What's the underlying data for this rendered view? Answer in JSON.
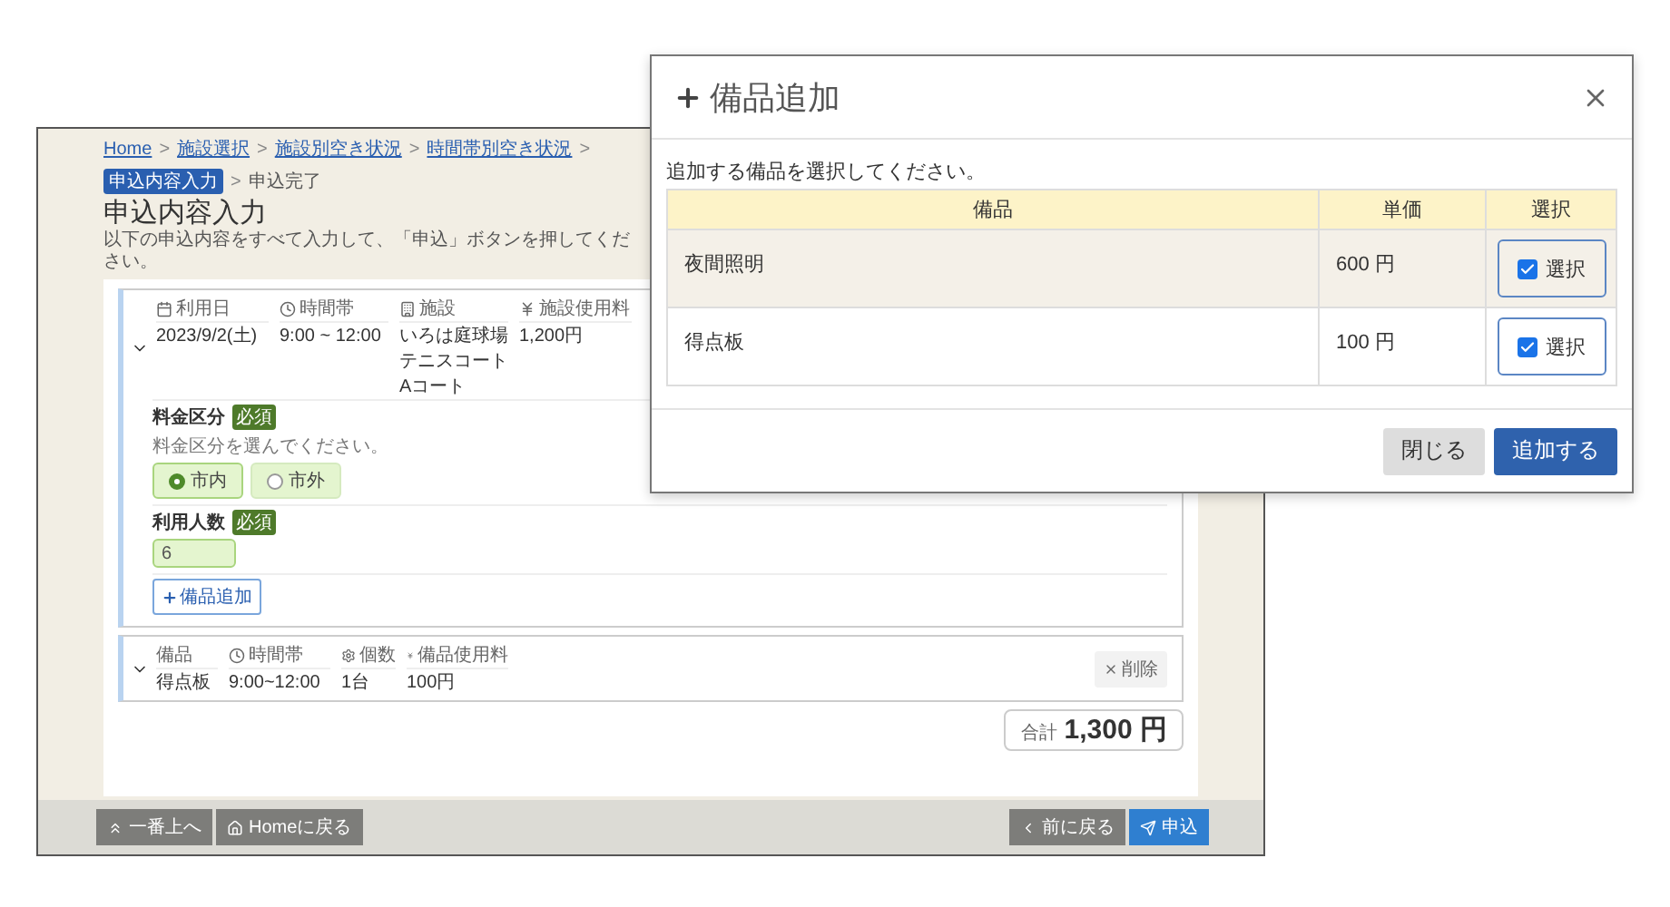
{
  "breadcrumb": [
    {
      "label": "Home",
      "kind": "link"
    },
    {
      "label": "施設選択",
      "kind": "link"
    },
    {
      "label": "施設別空き状況",
      "kind": "link"
    },
    {
      "label": "時間帯別空き状況",
      "kind": "link"
    },
    {
      "label": "申込内容入力",
      "kind": "current"
    },
    {
      "label": "申込完了",
      "kind": "plain"
    }
  ],
  "breadcrumb_separator": ">",
  "page": {
    "title": "申込内容入力",
    "description": "以下の申込内容をすべて入力して、「申込」ボタンを押してください。"
  },
  "usage": {
    "fields": [
      {
        "label": "利用日",
        "value": "2023/9/2(土)"
      },
      {
        "label": "時間帯",
        "value": "9:00 ~ 12:00"
      },
      {
        "label": "施設",
        "value": "いろは庭球場",
        "room": "テニスコート",
        "court": "Aコート"
      },
      {
        "label": "施設使用料",
        "value": "1,200円"
      }
    ]
  },
  "fee_category": {
    "label": "料金区分",
    "badge": "必須",
    "hint": "料金区分を選んでください。",
    "options": [
      {
        "label": "市内",
        "selected": true
      },
      {
        "label": "市外",
        "selected": false
      }
    ]
  },
  "headcount": {
    "label": "利用人数",
    "badge": "必須",
    "value": "6"
  },
  "add_equipment_button": "備品追加",
  "equipment": {
    "fields": [
      {
        "label": "備品",
        "value": "得点板"
      },
      {
        "label": "時間帯",
        "value": "9:00~12:00"
      },
      {
        "label": "個数",
        "value": "1台"
      },
      {
        "label": "備品使用料",
        "value": "100円"
      }
    ],
    "delete_button": "削除"
  },
  "total": {
    "label": "合計",
    "amount": "1,300 円"
  },
  "footer": {
    "left": [
      {
        "label": "一番上へ",
        "kind": "default"
      },
      {
        "label": "Homeに戻る",
        "kind": "default"
      }
    ],
    "right": [
      {
        "label": "前に戻る",
        "kind": "default"
      },
      {
        "label": "申込",
        "kind": "primary"
      }
    ]
  },
  "dialog": {
    "title": "備品追加",
    "instruction": "追加する備品を選択してください。",
    "columns": [
      "備品",
      "単価",
      "選択"
    ],
    "rows": [
      {
        "name": "夜間照明",
        "price": "600 円",
        "select_label": "選択",
        "checked": true,
        "highlighted": true
      },
      {
        "name": "得点板",
        "price": "100 円",
        "select_label": "選択",
        "checked": true,
        "highlighted": false
      }
    ],
    "buttons": [
      {
        "label": "閉じる",
        "kind": "default"
      },
      {
        "label": "追加する",
        "kind": "primary"
      }
    ]
  }
}
